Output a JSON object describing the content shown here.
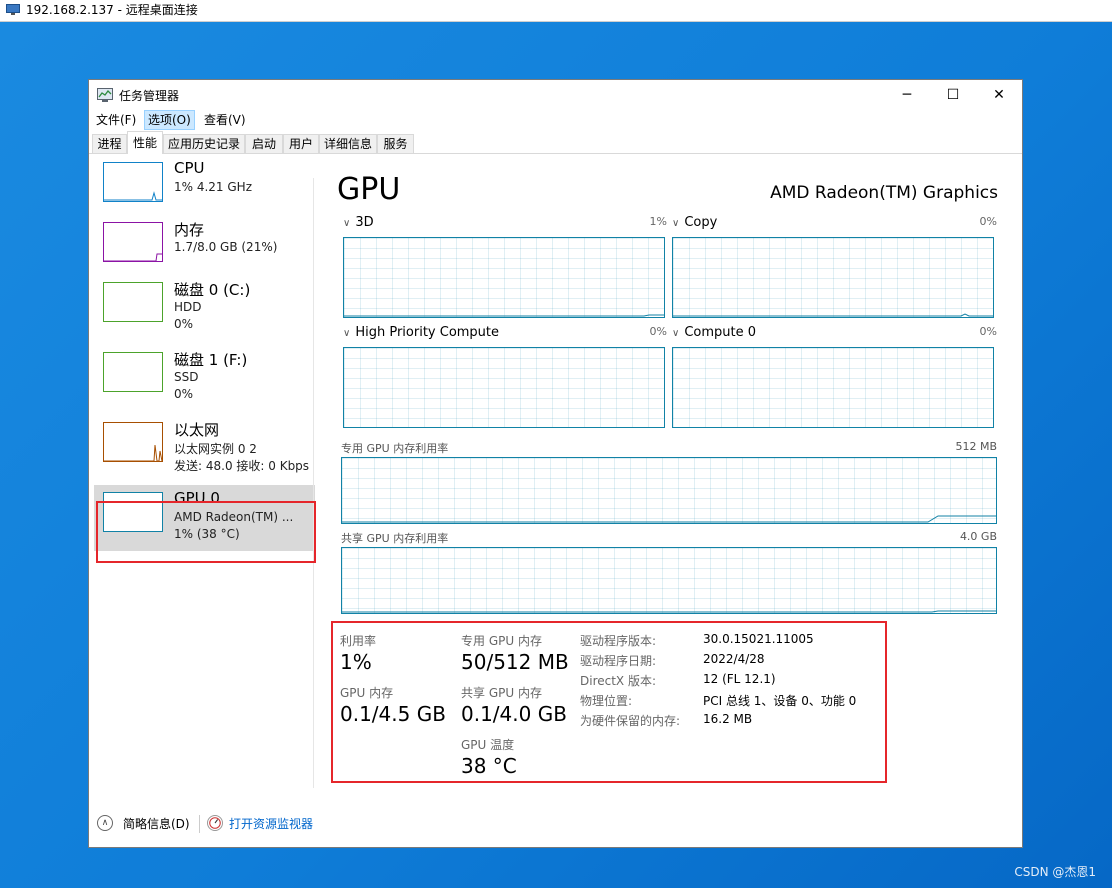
{
  "remote_desktop": {
    "title": "192.168.2.137 - 远程桌面连接"
  },
  "window": {
    "title": "任务管理器",
    "controls": {
      "minimize": "─",
      "maximize": "☐",
      "close": "✕"
    }
  },
  "menu": [
    {
      "label": "文件(F)"
    },
    {
      "label": "选项(O)"
    },
    {
      "label": "查看(V)"
    }
  ],
  "tabs": [
    {
      "label": "进程"
    },
    {
      "label": "性能"
    },
    {
      "label": "应用历史记录"
    },
    {
      "label": "启动"
    },
    {
      "label": "用户"
    },
    {
      "label": "详细信息"
    },
    {
      "label": "服务"
    }
  ],
  "sidebar": {
    "items": [
      {
        "name": "CPU",
        "line2": "1% 4.21 GHz",
        "line3": "",
        "color": "#1182c8"
      },
      {
        "name": "内存",
        "line2": "1.7/8.0 GB (21%)",
        "line3": "",
        "color": "#8b13a5"
      },
      {
        "name": "磁盘 0 (C:)",
        "line2": "HDD",
        "line3": "0%",
        "color": "#4ca32b"
      },
      {
        "name": "磁盘 1 (F:)",
        "line2": "SSD",
        "line3": "0%",
        "color": "#4ca32b"
      },
      {
        "name": "以太网",
        "line2": "以太网实例 0 2",
        "line3": "发送: 48.0 接收: 0 Kbps",
        "color": "#a74f01"
      },
      {
        "name": "GPU 0",
        "line2": "AMD Radeon(TM) ...",
        "line3": "1% (38 °C)",
        "color": "#1182a6"
      }
    ]
  },
  "gpu": {
    "title": "GPU",
    "model": "AMD Radeon(TM) Graphics",
    "engines": [
      {
        "label": "3D",
        "percent": "1%"
      },
      {
        "label": "Copy",
        "percent": "0%"
      },
      {
        "label": "High Priority Compute",
        "percent": "0%"
      },
      {
        "label": "Compute 0",
        "percent": "0%"
      }
    ],
    "dedicated_memory": {
      "label": "专用 GPU 内存利用率",
      "capacity": "512 MB"
    },
    "shared_memory": {
      "label": "共享 GPU 内存利用率",
      "capacity": "4.0 GB"
    }
  },
  "stats": {
    "utilization": {
      "label": "利用率",
      "value": "1%"
    },
    "dedicated": {
      "label": "专用 GPU 内存",
      "value": "50/512 MB"
    },
    "gpu_memory": {
      "label": "GPU 内存",
      "value": "0.1/4.5 GB"
    },
    "shared": {
      "label": "共享 GPU 内存",
      "value": "0.1/4.0 GB"
    },
    "temperature": {
      "label": "GPU 温度",
      "value": "38 °C"
    }
  },
  "properties": [
    {
      "label": "驱动程序版本:",
      "value": "30.0.15021.11005"
    },
    {
      "label": "驱动程序日期:",
      "value": "2022/4/28"
    },
    {
      "label": "DirectX 版本:",
      "value": "12 (FL 12.1)"
    },
    {
      "label": "物理位置:",
      "value": "PCI 总线 1、设备 0、功能 0"
    },
    {
      "label": "为硬件保留的内存:",
      "value": "16.2 MB"
    }
  ],
  "footer": {
    "fewer_details": "简略信息(D)",
    "resource_monitor": "打开资源监视器"
  },
  "watermark": "CSDN @杰恩1"
}
